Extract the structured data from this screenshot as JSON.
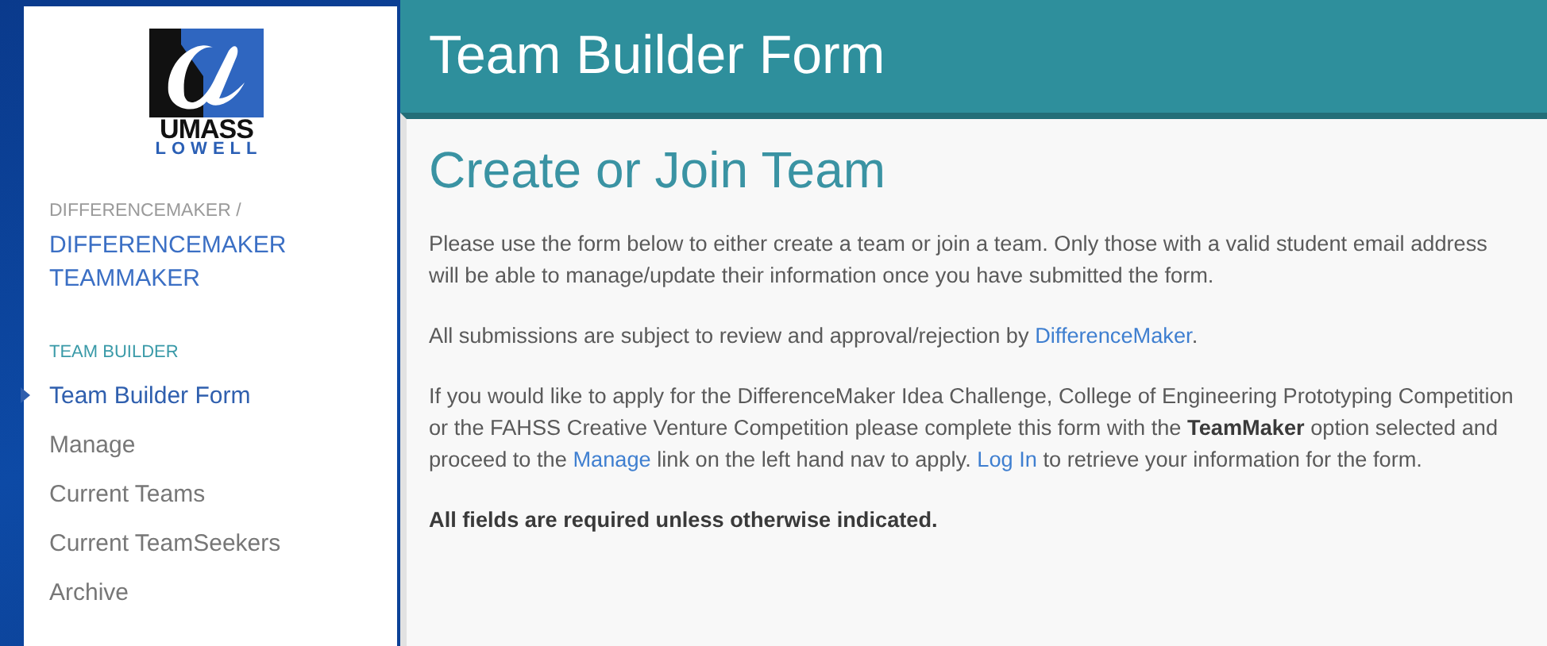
{
  "logo": {
    "line_1": "UMASS",
    "line_2": "LOWELL"
  },
  "sidebar": {
    "breadcrumb": "DIFFERENCEMAKER /",
    "title": "DIFFERENCEMAKER TEAMMAKER",
    "section": "TEAM BUILDER",
    "items": [
      {
        "label": "Team Builder Form",
        "selected": true
      },
      {
        "label": "Manage",
        "selected": false
      },
      {
        "label": "Current Teams",
        "selected": false
      },
      {
        "label": "Current TeamSeekers",
        "selected": false
      },
      {
        "label": "Archive",
        "selected": false
      }
    ]
  },
  "header": {
    "title": "Team Builder Form"
  },
  "content": {
    "heading": "Create or Join Team",
    "paragraphs": [
      [
        {
          "kind": "plain",
          "text": "Please use the form below to either create a team or join a team. Only those with a valid student email address will be able to manage/update their information once you have submitted the form."
        }
      ],
      [
        {
          "kind": "plain",
          "text": "All submissions are subject to review and approval/rejection by "
        },
        {
          "kind": "link",
          "text": "DifferenceMaker"
        },
        {
          "kind": "plain",
          "text": "."
        }
      ],
      [
        {
          "kind": "plain",
          "text": "If you would like to apply for the DifferenceMaker Idea Challenge, College of Engineering Prototyping Competition or the FAHSS Creative Venture Competition please complete this form with the "
        },
        {
          "kind": "bold",
          "text": "TeamMaker"
        },
        {
          "kind": "plain",
          "text": " option selected and proceed to the "
        },
        {
          "kind": "link",
          "text": "Manage"
        },
        {
          "kind": "plain",
          "text": " link on the left hand nav to apply. "
        },
        {
          "kind": "link",
          "text": "Log In"
        },
        {
          "kind": "plain",
          "text": " to retrieve your information for the form."
        }
      ],
      [
        {
          "kind": "bold",
          "text": "All fields are required unless otherwise indicated."
        }
      ]
    ]
  }
}
